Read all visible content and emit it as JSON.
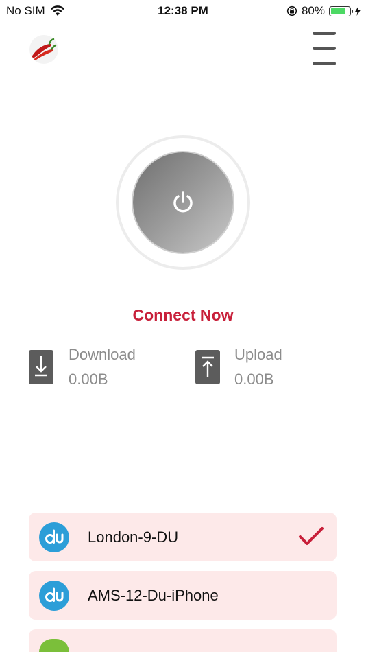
{
  "status_bar": {
    "carrier": "No SIM",
    "time": "12:38 PM",
    "battery_percent": "80%",
    "battery_level": 0.8,
    "icons": [
      "wifi-icon",
      "orientation-lock-icon",
      "battery-icon",
      "charging-icon"
    ]
  },
  "header": {
    "logo_icon": "chili-pepper-logo",
    "menu_icon": "hamburger-menu-icon"
  },
  "power": {
    "icon": "power-icon",
    "connect_label": "Connect Now"
  },
  "stats": {
    "download": {
      "label": "Download",
      "value": "0.00B",
      "icon": "download-icon"
    },
    "upload": {
      "label": "Upload",
      "value": "0.00B",
      "icon": "upload-icon"
    }
  },
  "servers": [
    {
      "name": "London-9-DU",
      "selected": true,
      "icon": "du-logo-icon"
    },
    {
      "name": "AMS-12-Du-iPhone",
      "selected": false,
      "icon": "du-logo-icon"
    }
  ],
  "colors": {
    "accent": "#c8203a",
    "server_bg": "#fde9e9",
    "du_blue": "#2c9ed8",
    "battery_green": "#4cd964"
  }
}
